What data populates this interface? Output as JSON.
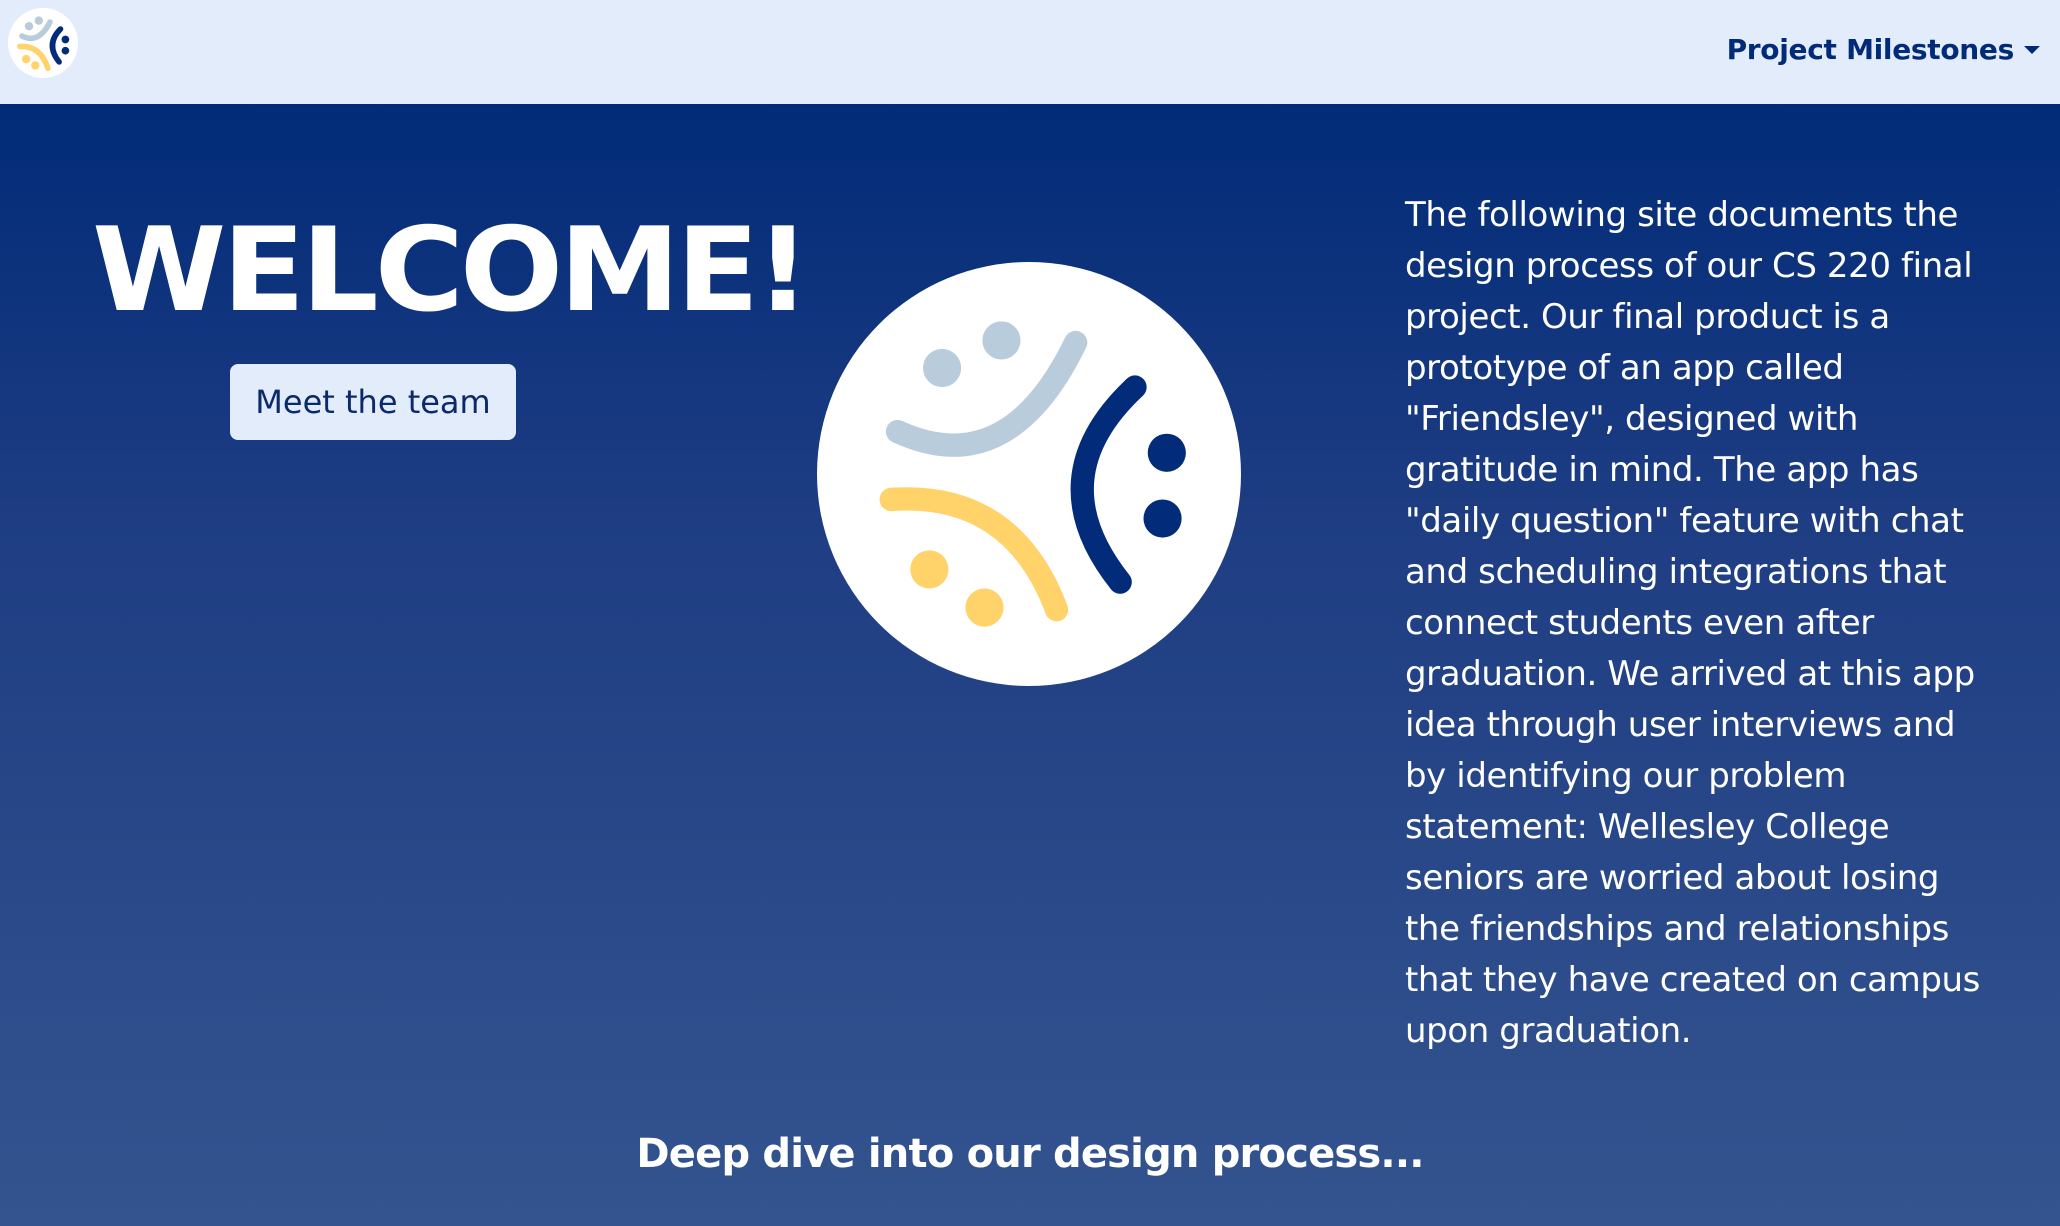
{
  "navbar": {
    "logo_icon": "friendsley-logo-icon",
    "menu_label": "Project Milestones",
    "menu_icon": "caret-down-icon"
  },
  "hero": {
    "title": "WELCOME!",
    "team_button_label": "Meet the team",
    "logo_icon": "friendsley-logo-icon",
    "description": "The following site documents the design process of our CS 220 final project. Our final product is a prototype of an app called \"Friendsley\", designed with gratitude in mind. The app has \"daily question\" feature with chat and scheduling integrations that connect students even after graduation. We arrived at this app idea through user interviews and by identifying our problem statement: Wellesley College seniors are worried about losing the friendships and relationships that they have created on campus upon graduation."
  },
  "section": {
    "heading": "Deep dive into our design process..."
  },
  "colors": {
    "navbar_bg": "#e3ecfb",
    "brand_navy": "#012b78",
    "logo_blue_gray": "#b9ccdb",
    "logo_yellow": "#ffd36a",
    "logo_navy": "#022b79"
  }
}
